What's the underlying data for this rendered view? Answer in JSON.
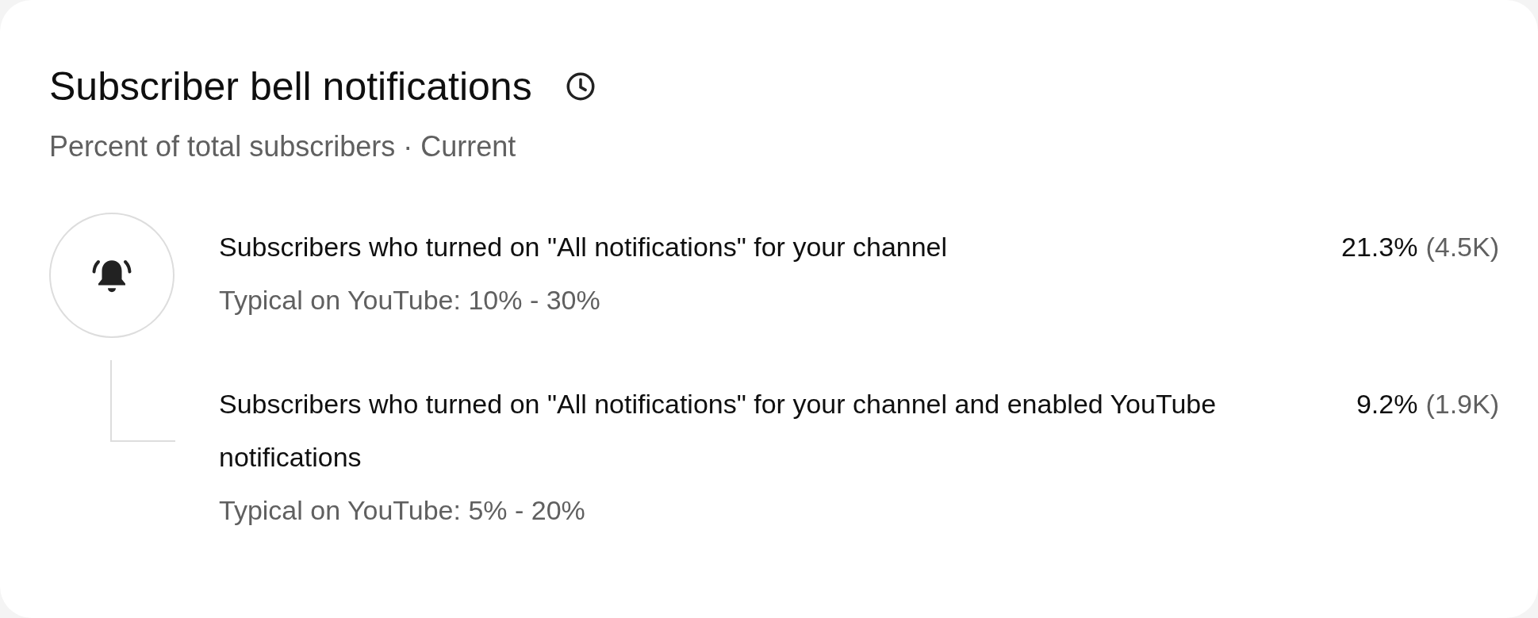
{
  "card": {
    "title": "Subscriber bell notifications",
    "subtitle": "Percent of total subscribers · Current",
    "rows": [
      {
        "kind": "main",
        "label": "Subscribers who turned on \"All notifications\" for your channel",
        "typical": "Typical on YouTube: 10% - 30%",
        "percent": "21.3%",
        "count": "(4.5K)"
      },
      {
        "kind": "sub",
        "label": "Subscribers who turned on \"All notifications\" for your channel and enabled YouTube notifications",
        "typical": "Typical on YouTube: 5% - 20%",
        "percent": "9.2%",
        "count": "(1.9K)"
      }
    ]
  }
}
